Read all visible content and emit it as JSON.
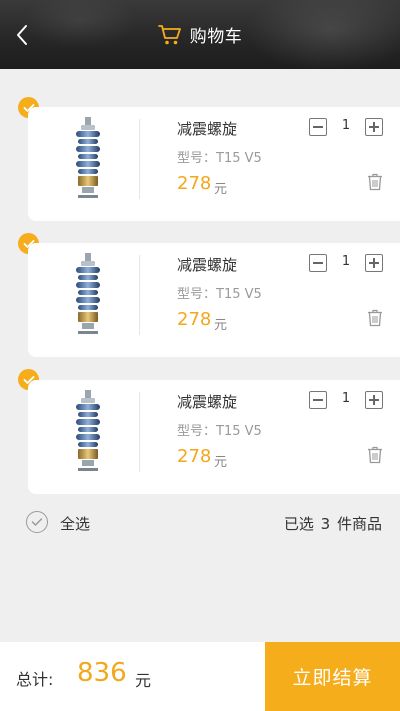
{
  "header": {
    "title": "购物车",
    "back_icon": "chevron-left-icon",
    "cart_icon": "shopping-cart-icon",
    "accent_color": "#f5ad1c"
  },
  "cart": {
    "items": [
      {
        "name": "减震螺旋",
        "model": "型号：T15 V5",
        "price": "278",
        "unit": "元",
        "qty": "1",
        "selected": true
      },
      {
        "name": "减震螺旋",
        "model": "型号：T15 V5",
        "price": "278",
        "unit": "元",
        "qty": "1",
        "selected": true
      },
      {
        "name": "减震螺旋",
        "model": "型号：T15 V5",
        "price": "278",
        "unit": "元",
        "qty": "1",
        "selected": true
      }
    ]
  },
  "select_all": {
    "label": "全选",
    "summary": "已选 3 件商品"
  },
  "footer": {
    "total_label": "总计:",
    "total_amount": "836",
    "total_unit": "元",
    "checkout_label": "立即结算"
  }
}
